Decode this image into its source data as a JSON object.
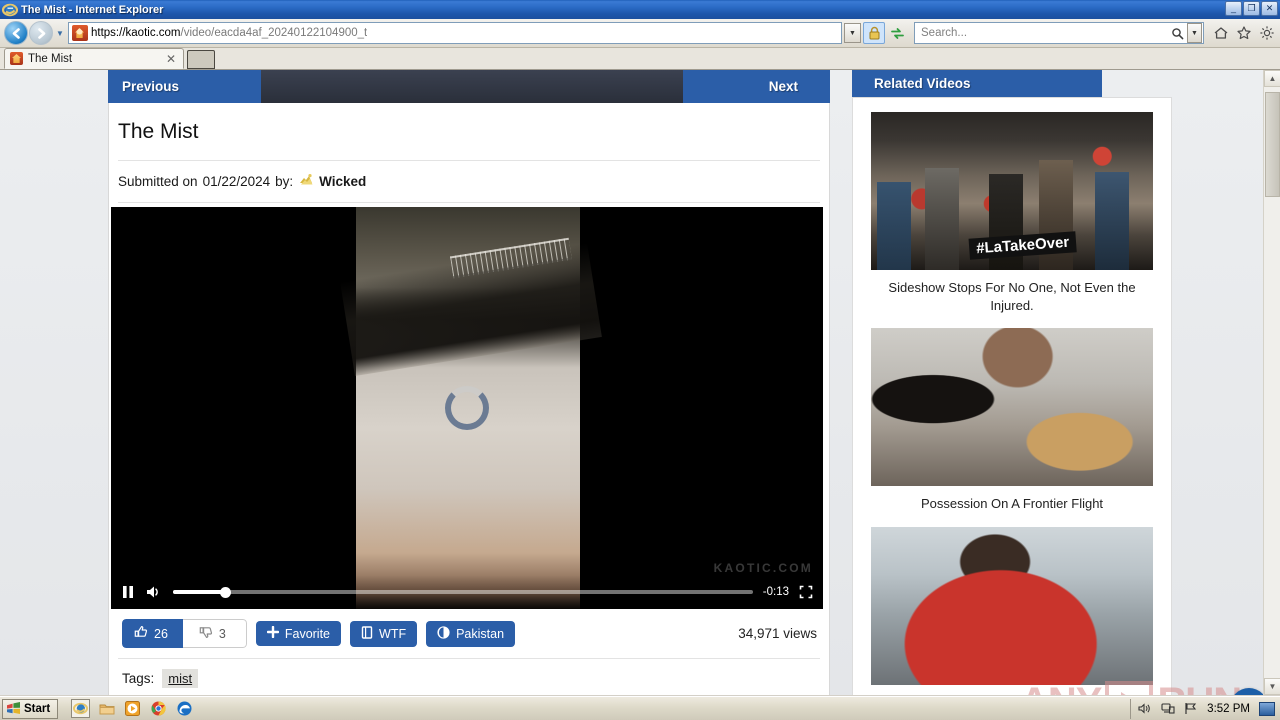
{
  "browser": {
    "window_title": "The Mist - Internet Explorer",
    "minimize_label": "_",
    "restore_label": "❐",
    "close_label": "✕",
    "address_scheme": "https://",
    "address_host": "kaotic.com",
    "address_path": "/video/eacda4af_20240122104900_t",
    "search_placeholder": "Search...",
    "tab_label": "The Mist",
    "tab_close_label": "✕",
    "icons": {
      "back": "back-arrow-icon",
      "forward": "forward-arrow-icon",
      "history": "history-dropdown-icon",
      "lock": "lock-icon",
      "refresh": "refresh-icon",
      "address_dropdown": "chevron-down-icon",
      "search": "search-icon",
      "home": "home-icon",
      "favorites": "star-icon",
      "tools": "gear-icon"
    }
  },
  "page": {
    "nav": {
      "previous_label": "Previous",
      "next_label": "Next"
    },
    "video": {
      "title": "The Mist",
      "submitted_prefix": "Submitted on",
      "submitted_date": "01/22/2024",
      "submitted_by_label": "by:",
      "submitter": "Wicked",
      "watermark": "KAOTIC.COM",
      "player": {
        "pause_label": "pause-button",
        "mute_label": "volume-button",
        "time_remaining": "-0:13",
        "fullscreen_label": "fullscreen-button",
        "progress_percent": 9,
        "volume_percent": 100
      },
      "actions": {
        "upvote_count": "26",
        "downvote_count": "3",
        "favorite_label": "Favorite",
        "wtf_label": "WTF",
        "country_label": "Pakistan",
        "views": "34,971 views"
      },
      "tags_label": "Tags:",
      "tags": [
        "mist"
      ]
    },
    "related": {
      "heading": "Related Videos",
      "items": [
        {
          "title": "Sideshow Stops For No One, Not Even the Injured.",
          "overlay_text": "#LaTakeOver"
        },
        {
          "title": "Possession On A Frontier Flight",
          "overlay_text": ""
        },
        {
          "title": "",
          "overlay_text": ""
        }
      ]
    },
    "watermark": {
      "any": "ANY",
      "run": "RUN"
    },
    "scroll_top_label": "scroll-to-top-button"
  },
  "taskbar": {
    "start_label": "Start",
    "clock": "3:52 PM",
    "quick_launch": [
      "internet-explorer-icon",
      "folder-icon",
      "media-player-icon",
      "chrome-icon",
      "edge-icon"
    ],
    "tray": [
      "volume-icon",
      "network-icon",
      "flag-icon"
    ]
  },
  "colors": {
    "accent_blue": "#2b5ea8",
    "title_blue": "#2a6ac4",
    "page_bg": "#e9eaec"
  }
}
